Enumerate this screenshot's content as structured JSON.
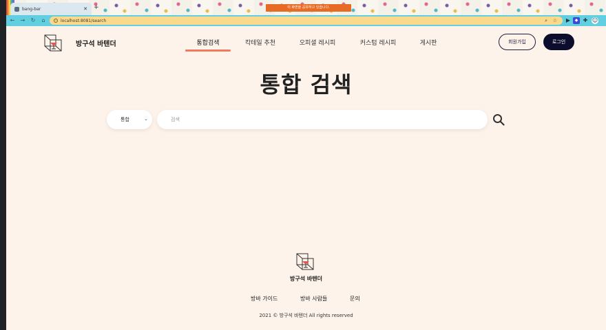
{
  "browser": {
    "tab_title": "bang-bar",
    "share_banner": "이 화면을 공유하고 있습니다.",
    "url": "localhost:8081/search"
  },
  "header": {
    "brand": "방구석 바텐더",
    "nav": [
      {
        "label": "통합검색",
        "active": true
      },
      {
        "label": "칵테일 추천",
        "active": false
      },
      {
        "label": "오피셜 레시피",
        "active": false
      },
      {
        "label": "커스텀 레시피",
        "active": false
      },
      {
        "label": "게시판",
        "active": false
      }
    ],
    "join_label": "회원가입",
    "login_label": "로그인"
  },
  "main": {
    "title": "통합 검색",
    "filter_selected": "통합",
    "search_placeholder": "검색"
  },
  "footer": {
    "brand": "방구석 바텐더",
    "links": [
      "방바 가이드",
      "방바 사람들",
      "문의"
    ],
    "copyright": "2021 © 방구석 바텐더 All rights reserved"
  },
  "colors": {
    "page_bg": "#fdf3ea",
    "accent": "#ef7a5d",
    "login_bg": "#0c0c2c",
    "toolbar": "#62cfe0",
    "urlbar": "#fbd98c"
  }
}
